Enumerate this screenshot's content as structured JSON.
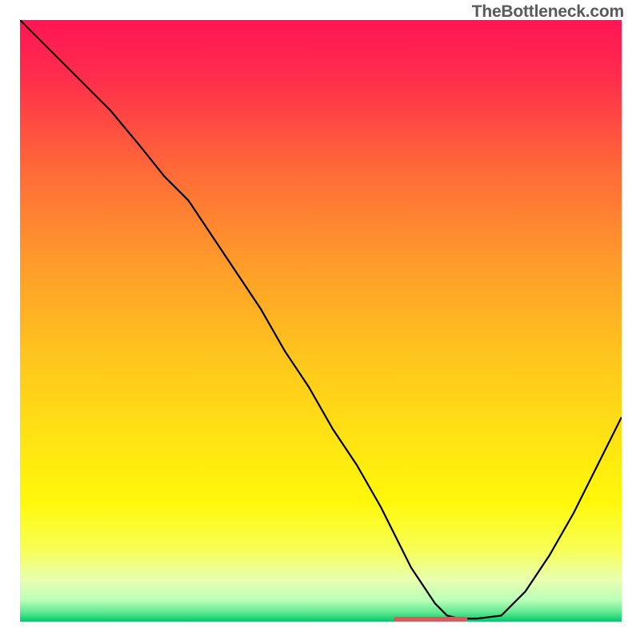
{
  "watermark": "TheBottleneck.com",
  "chart_data": {
    "type": "line",
    "title": "",
    "xlabel": "",
    "ylabel": "",
    "xlim": [
      0,
      100
    ],
    "ylim": [
      0,
      100
    ],
    "background_gradient": {
      "stops": [
        {
          "offset": 0.0,
          "color": "#ff1554"
        },
        {
          "offset": 0.1,
          "color": "#ff2f4b"
        },
        {
          "offset": 0.25,
          "color": "#ff6a38"
        },
        {
          "offset": 0.4,
          "color": "#ff9a2a"
        },
        {
          "offset": 0.55,
          "color": "#ffc31e"
        },
        {
          "offset": 0.7,
          "color": "#ffe412"
        },
        {
          "offset": 0.8,
          "color": "#fff80a"
        },
        {
          "offset": 0.88,
          "color": "#f7ff55"
        },
        {
          "offset": 0.93,
          "color": "#eaffb0"
        },
        {
          "offset": 0.965,
          "color": "#b8ffb8"
        },
        {
          "offset": 0.985,
          "color": "#5de88f"
        },
        {
          "offset": 1.0,
          "color": "#00c86a"
        }
      ]
    },
    "series": [
      {
        "name": "bottleneck-curve",
        "color": "#000000",
        "stroke_width": 2.2,
        "x": [
          0,
          5,
          10,
          15,
          20,
          24,
          28,
          32,
          36,
          40,
          44,
          48,
          52,
          56,
          60,
          63,
          65,
          67,
          69,
          71,
          73,
          76,
          80,
          84,
          88,
          92,
          96,
          100
        ],
        "y": [
          100,
          95,
          90,
          85,
          79,
          74,
          70,
          64,
          58,
          52,
          45,
          39,
          32,
          26,
          19,
          13,
          9,
          6,
          3,
          1,
          0.5,
          0.5,
          1,
          5,
          11,
          18,
          26,
          34
        ]
      },
      {
        "name": "optimal-marker",
        "color": "#d85a5a",
        "stroke_width": 6,
        "linecap": "round",
        "x": [
          62.5,
          74
        ],
        "y": [
          0.4,
          0.4
        ]
      }
    ]
  }
}
